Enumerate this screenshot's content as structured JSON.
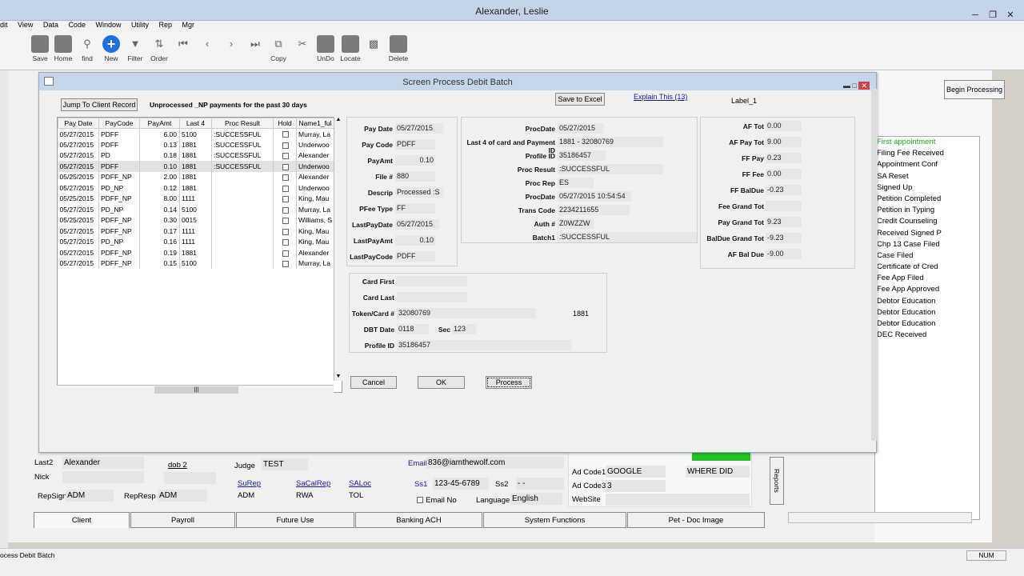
{
  "window": {
    "title": "Alexander, Leslie"
  },
  "menu": [
    "dit",
    "View",
    "Data",
    "Code",
    "Window",
    "Utility",
    "Rep",
    "Mgr"
  ],
  "toolbar": {
    "save": "Save",
    "home": "Home",
    "find": "find",
    "new": "New",
    "filter": "Filter",
    "order": "Order",
    "copy": "Copy",
    "undo": "UnDo",
    "locate": "Locate",
    "delete": "Delete"
  },
  "dialog": {
    "title": "Screen Process Debit Batch",
    "jump_label": "Jump To Client Record",
    "unprocessed_label": "Unprocessed _NP payments for the past 30 days",
    "save_excel": "Save to Excel",
    "explain": "Explain This (13)",
    "label_1": "Label_1",
    "begin_processing": "Begin Processing",
    "cancel": "Cancel",
    "ok": "OK",
    "process": "Process"
  },
  "grid": {
    "headers": [
      "Pay Date",
      "PayCode",
      "PayAmt",
      "Last 4",
      "Proc Result",
      "Hold",
      "Name1_ful"
    ],
    "rows": [
      [
        "05/27/2015",
        "PDFF",
        "6.00",
        "5100",
        ":SUCCESSFUL",
        "",
        "Murray, La"
      ],
      [
        "05/27/2015",
        "PDFF",
        "0.13",
        "1881",
        ":SUCCESSFUL",
        "",
        "Underwoo"
      ],
      [
        "05/27/2015",
        "PD",
        "0.18",
        "1881",
        ":SUCCESSFUL",
        "",
        "Alexander"
      ],
      [
        "05/27/2015",
        "PDFF",
        "0.10",
        "1881",
        ":SUCCESSFUL",
        "",
        "Underwoo"
      ],
      [
        "05/25/2015",
        "PDFF_NP",
        "2.00",
        "1881",
        "",
        "",
        "Alexander"
      ],
      [
        "05/27/2015",
        "PD_NP",
        "0.12",
        "1881",
        "",
        "",
        "Underwoo"
      ],
      [
        "05/25/2015",
        "PDFF_NP",
        "8.00",
        "1111",
        "",
        "",
        "King, Mau"
      ],
      [
        "05/27/2015",
        "PD_NP",
        "0.14",
        "5100",
        "",
        "",
        "Murray, La"
      ],
      [
        "05/25/2015",
        "PDFF_NP",
        "0.30",
        "0015",
        "",
        "",
        "Williams, S"
      ],
      [
        "05/27/2015",
        "PDFF_NP",
        "0.17",
        "1111",
        "",
        "",
        "King, Mau"
      ],
      [
        "05/27/2015",
        "PD_NP",
        "0.16",
        "1111",
        "",
        "",
        "King, Mau"
      ],
      [
        "05/27/2015",
        "PDFF_NP",
        "0.19",
        "1881",
        "",
        "",
        "Alexander"
      ],
      [
        "05/27/2015",
        "PDFF_NP",
        "0.15",
        "5100",
        "",
        "",
        "Murray, La"
      ]
    ]
  },
  "left_fields": {
    "pay_date": {
      "label": "Pay Date",
      "value": "05/27/2015"
    },
    "pay_code": {
      "label": "Pay Code",
      "value": "PDFF"
    },
    "pay_amt": {
      "label": "PayAmt",
      "value": "0.10"
    },
    "file_no": {
      "label": "File #",
      "value": "880"
    },
    "descrip": {
      "label": "Descrip",
      "value": "Processed :S"
    },
    "pfee_type": {
      "label": "PFee Type",
      "value": "FF"
    },
    "last_pay_date": {
      "label": "LastPayDate",
      "value": "05/27/2015"
    },
    "last_pay_amt": {
      "label": "LastPayAmt",
      "value": "0.10"
    },
    "last_pay_code": {
      "label": "LastPayCode",
      "value": "PDFF"
    }
  },
  "proc_fields": {
    "proc_date": {
      "label": "ProcDate",
      "value": "05/27/2015"
    },
    "last4_id": {
      "label": "Last 4 of card and Payment ID",
      "value": "1881 - 32080769"
    },
    "profile_id": {
      "label": "Profile ID",
      "value": "35186457"
    },
    "proc_result": {
      "label": "Proc Result",
      "value": ":SUCCESSFUL"
    },
    "proc_rep": {
      "label": "Proc Rep",
      "value": "ES"
    },
    "proc_date2": {
      "label": "ProcDate",
      "value": "05/27/2015 10:54:54"
    },
    "trans_code": {
      "label": "Trans Code",
      "value": "2234211655"
    },
    "auth": {
      "label": "Auth #",
      "value": "Z0WZZW"
    },
    "batch1": {
      "label": "Batch1",
      "value": ":SUCCESSFUL"
    }
  },
  "totals": {
    "af_tot": {
      "label": "AF Tot",
      "value": "0.00"
    },
    "af_pay_tot": {
      "label": "AF Pay Tot",
      "value": "9.00"
    },
    "ff_pay": {
      "label": "FF Pay",
      "value": "0.23"
    },
    "ff_fee": {
      "label": "FF Fee",
      "value": "0.00"
    },
    "ff_baldue": {
      "label": "FF BalDue",
      "value": "-0.23"
    },
    "fee_grand_tot": {
      "label": "Fee Grand Tot",
      "value": ""
    },
    "pay_grand_tot": {
      "label": "Pay Grand Tot",
      "value": "9.23"
    },
    "baldue_grand_tot": {
      "label": "BalDue Grand Tot",
      "value": "-9.23"
    },
    "af_bal_due": {
      "label": "AF Bal Due",
      "value": "-9.00"
    }
  },
  "card": {
    "card_first": {
      "label": "Card First",
      "value": ""
    },
    "card_last": {
      "label": "Card Last",
      "value": ""
    },
    "token": {
      "label": "Token/Card #",
      "value": "32080769"
    },
    "token_last4": "1881",
    "dbt_date": {
      "label": "DBT Date",
      "value": "0118"
    },
    "sec": {
      "label": "Sec",
      "value": "123"
    },
    "profile_id": {
      "label": "Profile ID",
      "value": "35186457"
    }
  },
  "right_list": [
    "First appointment",
    "Filing Fee Received",
    "Appointment Conf",
    "SA Reset",
    "Signed Up",
    "Petition Completed",
    "Petition in Typing",
    "Credit Counseling",
    "Received Signed P",
    "Chp 13 Case Filed",
    "Case Filed",
    "Certificate of Cred",
    "Fee App Filed",
    "Fee App Approved",
    "Debtor Education",
    "Debtor Education",
    "Debtor Education",
    "DEC Received"
  ],
  "client": {
    "last2_label": "Last2",
    "last2": "Alexander",
    "nick_label": "Nick",
    "dob2_label": "dob 2",
    "judge_label": "Judge",
    "judge": "TEST",
    "email_label": "Email",
    "email": "836@iamthewolf.com",
    "repsign_label": "RepSign",
    "repsign": "ADM",
    "represp_label": "RepResp",
    "represp": "ADM",
    "surep_label": "SuRep",
    "surep": "ADM",
    "sacalrep_label": "SaCalRep",
    "sacalrep": "RWA",
    "saloc_label": "SALoc",
    "saloc": "TOL",
    "ss1_label": "Ss1",
    "ss1": "123-45-6789",
    "ss2_label": "Ss2",
    "ss2": "-  -",
    "email_no": "Email No",
    "language_label": "Language",
    "language": "English",
    "adcode1_label": "Ad Code1",
    "adcode1": "GOOGLE",
    "where_did": "WHERE DID",
    "adcode3_label": "Ad Code3",
    "adcode3": "3",
    "website_label": "WebSite",
    "reports": "Reports"
  },
  "tabs": [
    "Client",
    "Payroll",
    "Future Use",
    "Banking ACH",
    "System Functions",
    "Pet - Doc Image"
  ],
  "status": {
    "left": "ocess Debit Batch",
    "num": "NUM"
  },
  "colors": {
    "accent_green": "#22c322",
    "link_blue": "#1a1aaa",
    "title_bar": "#c6d6ea"
  }
}
